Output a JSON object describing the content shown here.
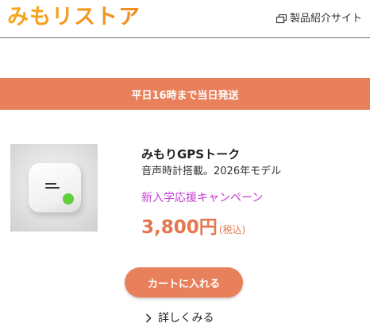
{
  "header": {
    "logo_text": "みもリストア",
    "product_site_label": "製品紹介サイト",
    "product_site_icon": "external-window-icon"
  },
  "banner": {
    "text": "平日16時まで当日発送"
  },
  "product": {
    "name": "みもりGPSトーク",
    "description": "音声時計搭載。2026年モデル",
    "campaign": "新入学応援キャンペーン",
    "price": "3,800円",
    "tax_note": "(税込)",
    "image_icon": "gps-device-image"
  },
  "actions": {
    "cart_label": "カートに入れる",
    "detail_label": "詳しくみる",
    "detail_icon": "chevron-right-icon"
  },
  "colors": {
    "accent": "#e8805c",
    "campaign": "#c23fd1",
    "logo": "#f6a81c"
  }
}
